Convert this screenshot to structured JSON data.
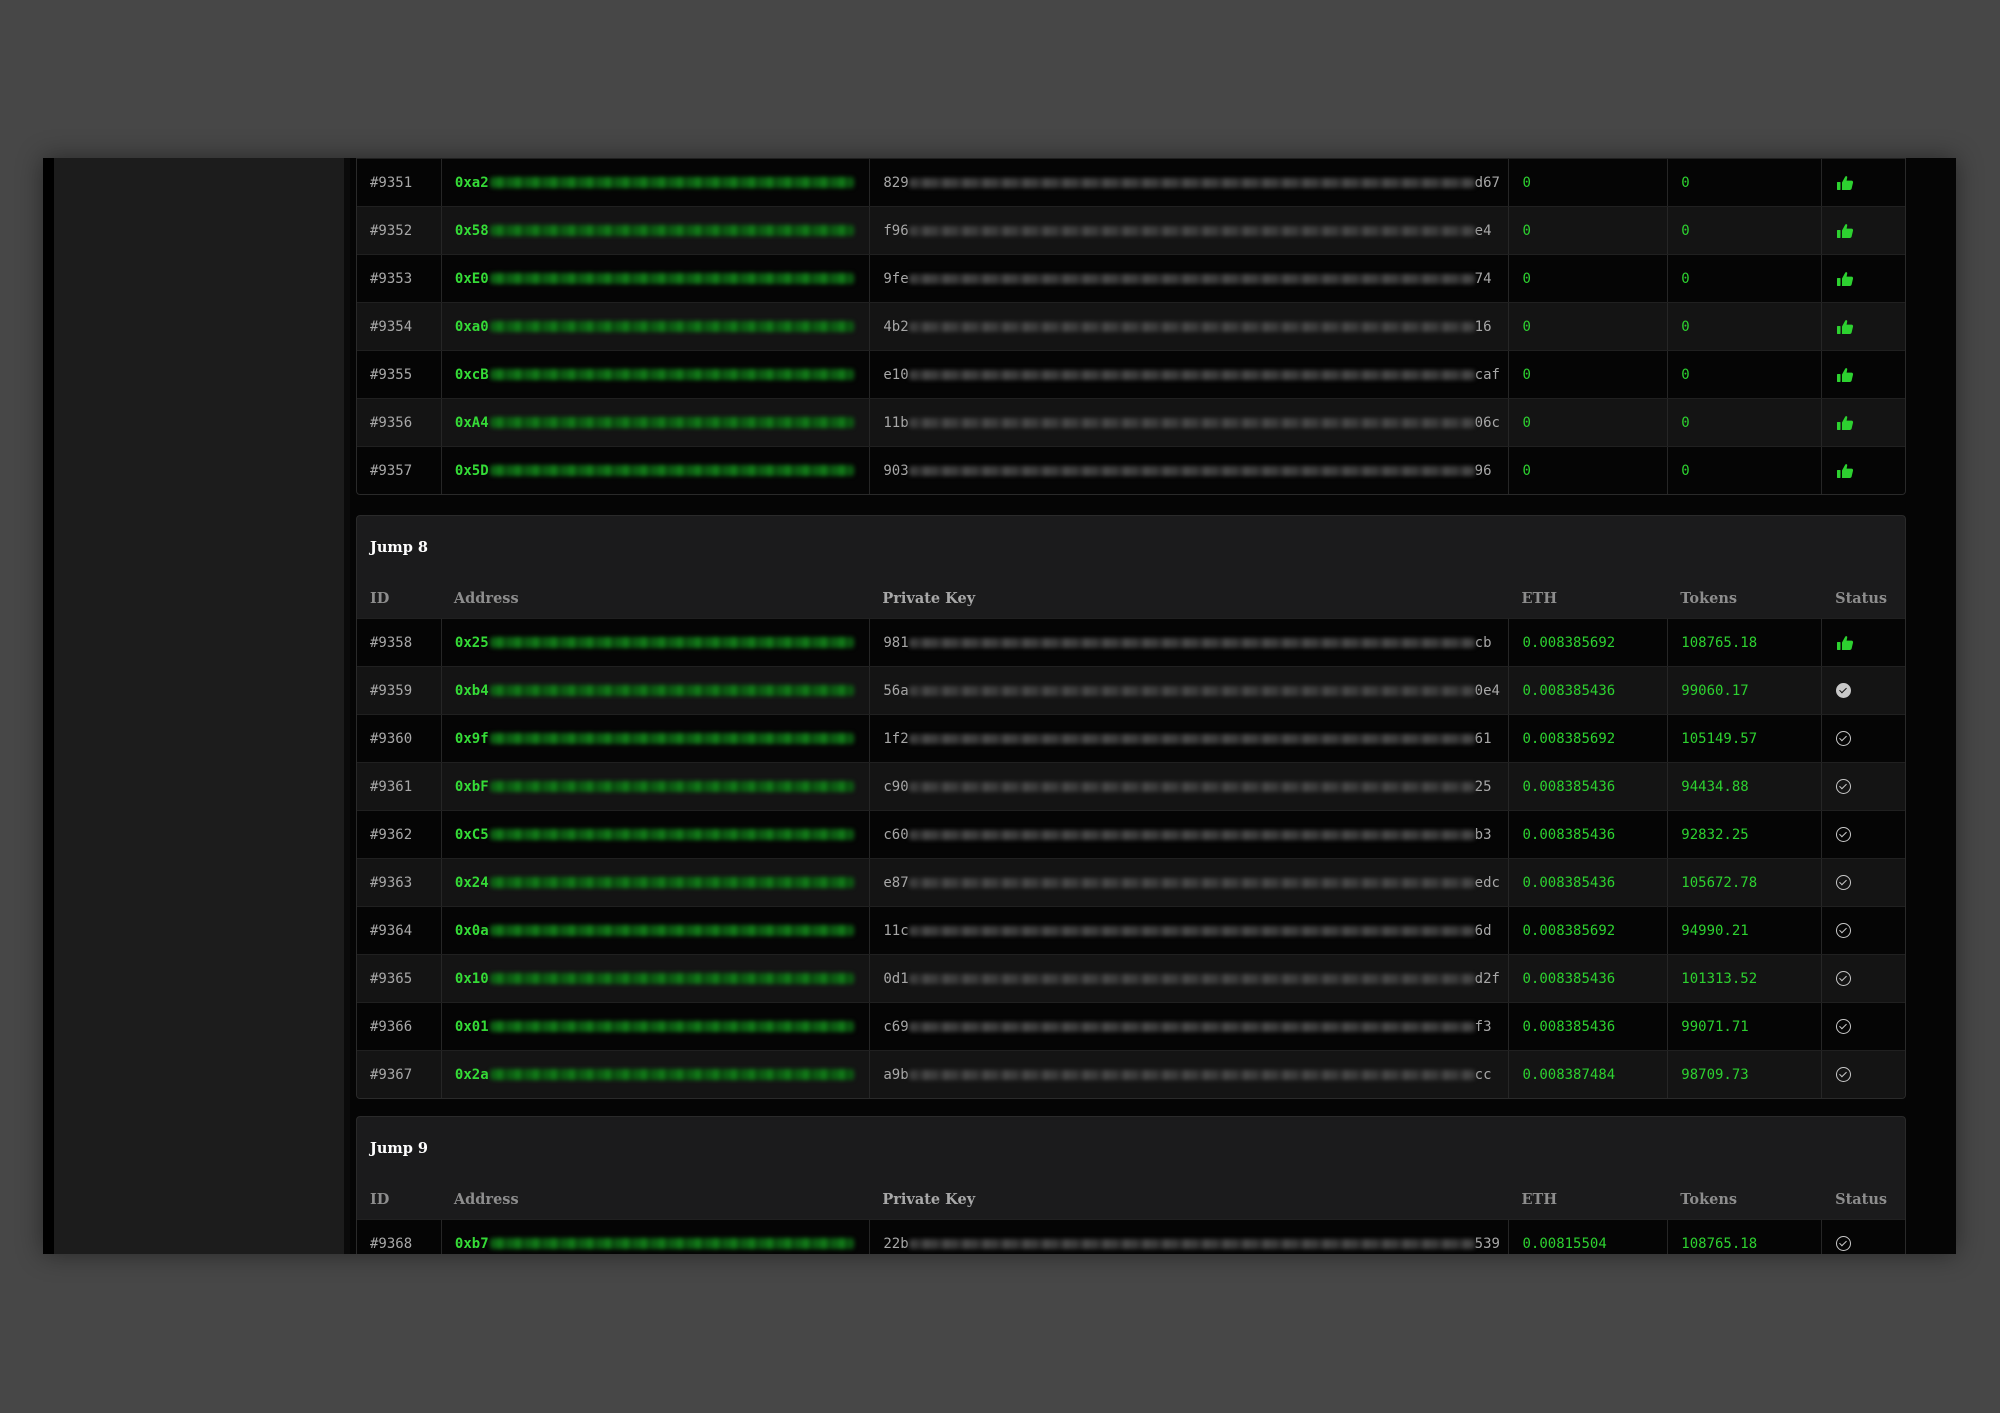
{
  "colors": {
    "accent_green": "#2dd130",
    "background": "#474747",
    "panel": "#1b1b1c"
  },
  "table_headers": {
    "id": "ID",
    "address": "Address",
    "private_key": "Private Key",
    "eth": "ETH",
    "tokens": "Tokens",
    "status": "Status"
  },
  "groups": [
    {
      "title": "",
      "rows": [
        {
          "id": "#9351",
          "addr_prefix": "0xa2",
          "pk_start": "829",
          "pk_end": "d67",
          "eth": "0",
          "tokens": "0",
          "status": "thumbs-up-icon"
        },
        {
          "id": "#9352",
          "addr_prefix": "0x58",
          "pk_start": "f96",
          "pk_end": "e4",
          "eth": "0",
          "tokens": "0",
          "status": "thumbs-up-icon"
        },
        {
          "id": "#9353",
          "addr_prefix": "0xE0",
          "pk_start": "9fe",
          "pk_end": "74",
          "eth": "0",
          "tokens": "0",
          "status": "thumbs-up-icon"
        },
        {
          "id": "#9354",
          "addr_prefix": "0xa0",
          "pk_start": "4b2",
          "pk_end": "16",
          "eth": "0",
          "tokens": "0",
          "status": "thumbs-up-icon"
        },
        {
          "id": "#9355",
          "addr_prefix": "0xcB",
          "pk_start": "e10",
          "pk_end": "caf",
          "eth": "0",
          "tokens": "0",
          "status": "thumbs-up-icon"
        },
        {
          "id": "#9356",
          "addr_prefix": "0xA4",
          "pk_start": "11b",
          "pk_end": "06c",
          "eth": "0",
          "tokens": "0",
          "status": "thumbs-up-icon"
        },
        {
          "id": "#9357",
          "addr_prefix": "0x5D",
          "pk_start": "903",
          "pk_end": "96",
          "eth": "0",
          "tokens": "0",
          "status": "thumbs-up-icon"
        }
      ]
    },
    {
      "title": "Jump 8",
      "rows": [
        {
          "id": "#9358",
          "addr_prefix": "0x25",
          "pk_start": "981",
          "pk_end": "cb",
          "eth": "0.008385692",
          "tokens": "108765.18",
          "status": "thumbs-up-icon"
        },
        {
          "id": "#9359",
          "addr_prefix": "0xb4",
          "pk_start": "56a",
          "pk_end": "0e4",
          "eth": "0.008385436",
          "tokens": "99060.17",
          "status": "check-filled-icon"
        },
        {
          "id": "#9360",
          "addr_prefix": "0x9f",
          "pk_start": "1f2",
          "pk_end": "61",
          "eth": "0.008385692",
          "tokens": "105149.57",
          "status": "check-circle-icon"
        },
        {
          "id": "#9361",
          "addr_prefix": "0xbF",
          "pk_start": "c90",
          "pk_end": "25",
          "eth": "0.008385436",
          "tokens": "94434.88",
          "status": "check-circle-icon"
        },
        {
          "id": "#9362",
          "addr_prefix": "0xC5",
          "pk_start": "c60",
          "pk_end": "b3",
          "eth": "0.008385436",
          "tokens": "92832.25",
          "status": "check-circle-icon"
        },
        {
          "id": "#9363",
          "addr_prefix": "0x24",
          "pk_start": "e87",
          "pk_end": "edc",
          "eth": "0.008385436",
          "tokens": "105672.78",
          "status": "check-circle-icon"
        },
        {
          "id": "#9364",
          "addr_prefix": "0x0a",
          "pk_start": "11c",
          "pk_end": "6d",
          "eth": "0.008385692",
          "tokens": "94990.21",
          "status": "check-circle-icon"
        },
        {
          "id": "#9365",
          "addr_prefix": "0x10",
          "pk_start": "0d1",
          "pk_end": "d2f",
          "eth": "0.008385436",
          "tokens": "101313.52",
          "status": "check-circle-icon"
        },
        {
          "id": "#9366",
          "addr_prefix": "0x01",
          "pk_start": "c69",
          "pk_end": "f3",
          "eth": "0.008385436",
          "tokens": "99071.71",
          "status": "check-circle-icon"
        },
        {
          "id": "#9367",
          "addr_prefix": "0x2a",
          "pk_start": "a9b",
          "pk_end": "cc",
          "eth": "0.008387484",
          "tokens": "98709.73",
          "status": "check-circle-icon"
        }
      ]
    },
    {
      "title": "Jump 9",
      "rows": [
        {
          "id": "#9368",
          "addr_prefix": "0xb7",
          "pk_start": "22b",
          "pk_end": "539",
          "eth": "0.00815504",
          "tokens": "108765.18",
          "status": "check-circle-icon"
        }
      ]
    }
  ]
}
